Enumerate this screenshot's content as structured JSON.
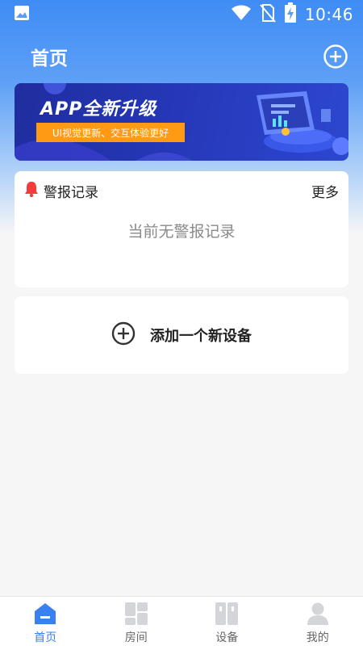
{
  "status_bar": {
    "time": "10:46",
    "icons": [
      "image-icon",
      "wifi-icon",
      "no-sim-icon",
      "battery-charging-icon"
    ]
  },
  "header": {
    "title": "首页",
    "add_icon": "add-circle-icon"
  },
  "banner": {
    "title": "APP全新升级",
    "subtitle": "UI视觉更新、交互体验更好"
  },
  "alarm": {
    "title": "警报记录",
    "more": "更多",
    "empty_text": "当前无警报记录",
    "icon": "bell-icon"
  },
  "add_device": {
    "label": "添加一个新设备",
    "icon": "add-circle-icon"
  },
  "nav": {
    "items": [
      {
        "label": "首页",
        "icon": "home-icon",
        "active": true
      },
      {
        "label": "房间",
        "icon": "room-icon",
        "active": false
      },
      {
        "label": "设备",
        "icon": "device-icon",
        "active": false
      },
      {
        "label": "我的",
        "icon": "user-icon",
        "active": false
      }
    ]
  },
  "colors": {
    "primary": "#3a80f0",
    "alarm_red": "#f23b3b",
    "banner_orange": "#ff9a14"
  }
}
